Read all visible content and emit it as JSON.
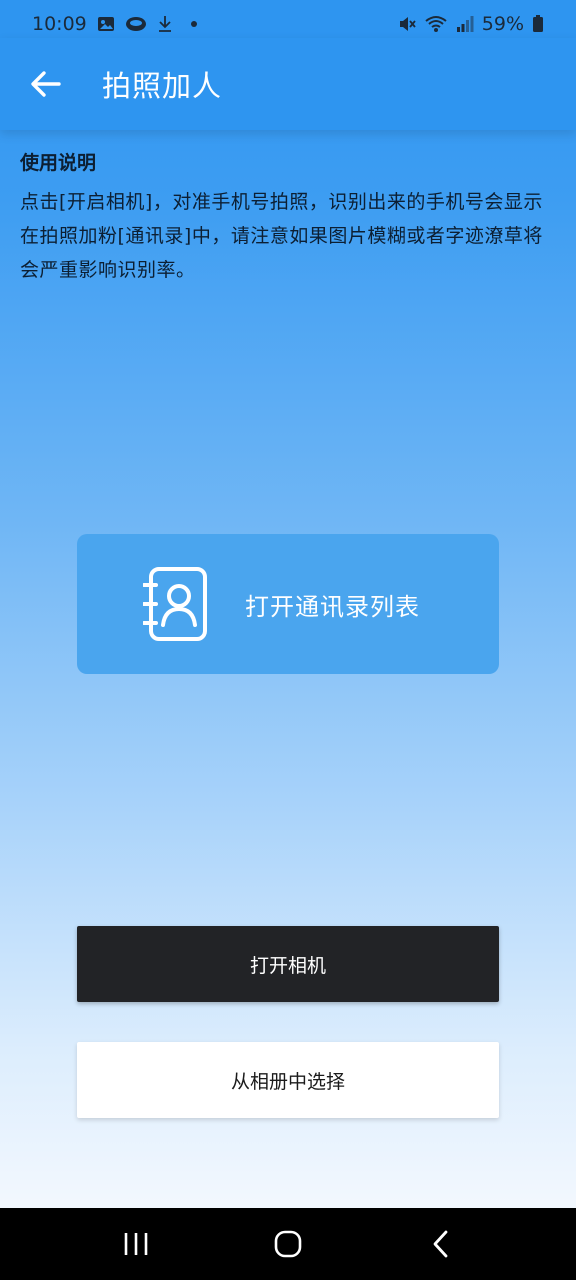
{
  "status_bar": {
    "time": "10:09",
    "battery": "59%",
    "icons": [
      "image-icon",
      "app-icon",
      "download-icon",
      "dot-icon",
      "mute-icon",
      "wifi-icon",
      "signal-icon",
      "battery-icon"
    ]
  },
  "app_bar": {
    "title": "拍照加人",
    "back_icon": "arrow-left-icon"
  },
  "instructions": {
    "title": "使用说明",
    "body": "点击[开启相机]，对准手机号拍照，识别出来的手机号会显示在拍照加粉[通讯录]中，请注意如果图片模糊或者字迹潦草将会严重影响识别率。"
  },
  "contacts_card": {
    "label": "打开通讯录列表",
    "icon": "contacts-book-icon"
  },
  "buttons": {
    "camera": "打开相机",
    "album": "从相册中选择"
  },
  "nav_bar": {
    "icons": [
      "recent-apps-icon",
      "home-icon",
      "back-icon"
    ]
  },
  "colors": {
    "primary": "#2e95f0",
    "card": "#4aa5ee",
    "dark_button": "#222326"
  }
}
